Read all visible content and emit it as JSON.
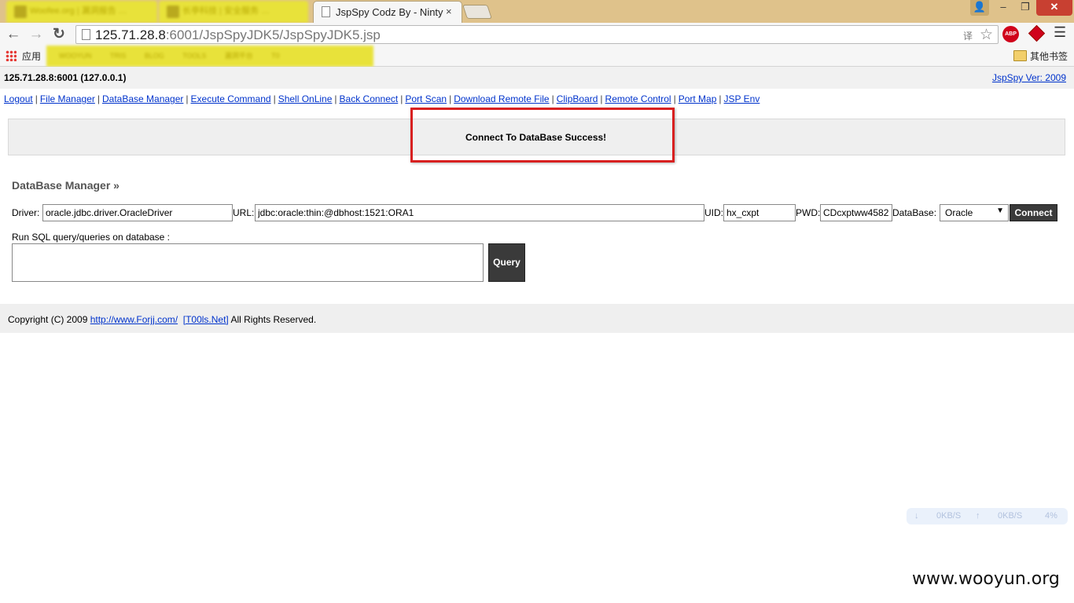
{
  "browser": {
    "tabs": [
      {
        "label": "Woofee.org | 漏洞报告 …",
        "blurred": true
      },
      {
        "label": "长亭科技 | 安全服务 …",
        "blurred": true
      },
      {
        "label": "JspSpy Codz By - Ninty",
        "active": true
      }
    ],
    "tab_close": "×",
    "url_host": "125.71.28.8",
    "url_rest": ":6001/JspSpyJDK5/JspSpyJDK5.jsp",
    "apps_label": "应用",
    "bookmarks": [
      "WOOYUN",
      "TRIS",
      "BLOG",
      "TOOLS",
      "漏洞平台",
      "T0"
    ],
    "other_bookmarks": "其他书签",
    "abp_label": "ABP",
    "icons": {
      "back": "←",
      "forward": "→",
      "reload": "↻",
      "star": "☆",
      "menu": "☰",
      "translate": "译"
    },
    "window": {
      "user": "👤",
      "minimize": "‒",
      "maximize": "❐",
      "close": "✕"
    }
  },
  "header": {
    "server": "125.71.28.8:6001 (127.0.0.1)",
    "version": "JspSpy Ver: 2009"
  },
  "nav": [
    "Logout",
    "File Manager",
    "DataBase Manager",
    "Execute Command",
    "Shell OnLine",
    "Back Connect",
    "Port Scan",
    "Download Remote File",
    "ClipBoard",
    "Remote Control",
    "Port Map",
    "JSP Env"
  ],
  "message": "Connect To DataBase Success!",
  "db": {
    "title": "DataBase Manager »",
    "driver_label": "Driver:",
    "driver_value": "oracle.jdbc.driver.OracleDriver",
    "url_label": "URL:",
    "url_value": "jdbc:oracle:thin:@dbhost:1521:ORA1",
    "uid_label": "UID:",
    "uid_value": "hx_cxpt",
    "pwd_label": "PWD:",
    "pwd_value": "CDcxptww4582",
    "database_label": "DataBase:",
    "database_value": "Oracle",
    "connect_label": "Connect",
    "sql_label": "Run SQL query/queries on database :",
    "query_label": "Query"
  },
  "footer": {
    "prefix": "Copyright (C) 2009 ",
    "link1": "http://www.Forjj.com/",
    "link2": "[T00ls.Net]",
    "suffix": " All Rights Reserved."
  },
  "overlay": {
    "down": "0KB/S",
    "up": "0KB/S",
    "cpu": "4%",
    "watermark": "www.wooyun.org"
  }
}
